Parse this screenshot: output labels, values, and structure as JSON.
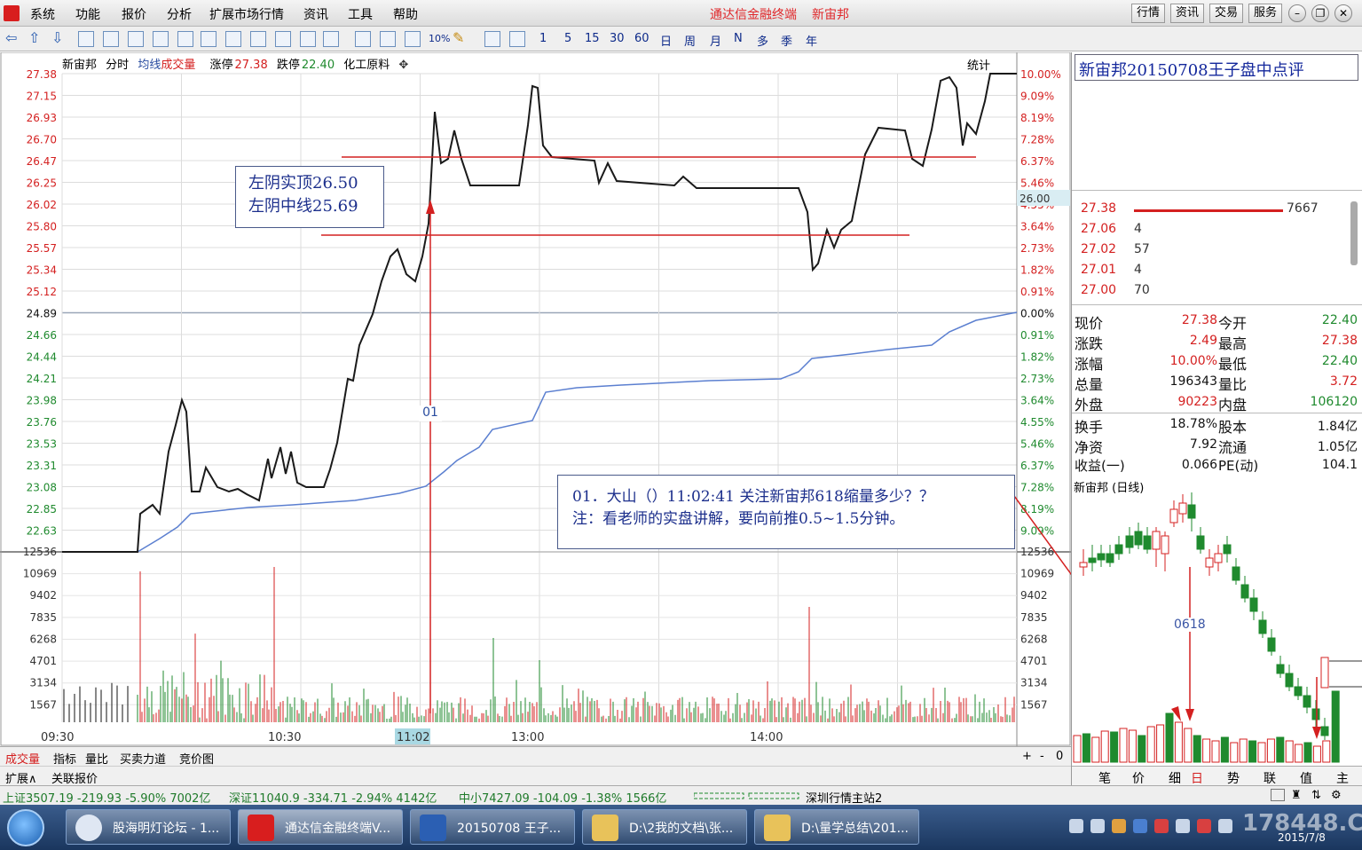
{
  "menu": {
    "items": [
      "系统",
      "功能",
      "报价",
      "分析",
      "扩展市场行情",
      "资讯",
      "工具",
      "帮助"
    ],
    "app_title": "通达信金融终端",
    "stock_title": "新宙邦",
    "right_buttons": [
      "行情",
      "资讯",
      "交易",
      "服务"
    ]
  },
  "toolbar": {
    "periods": [
      "1",
      "5",
      "15",
      "30",
      "60",
      "日",
      "周",
      "月",
      "N",
      "多",
      "季",
      "年"
    ],
    "pct_label": "10%"
  },
  "chart": {
    "stock_name": "新宙邦",
    "mode": "分时",
    "avg_label": "均线",
    "vol_label": "成交量",
    "limit_up_label": "涨停",
    "limit_up_value": "27.38",
    "limit_down_label": "跌停",
    "limit_down_value": "22.40",
    "sector": "化工原料",
    "stat_label": "统计",
    "price_ticks": [
      "27.38",
      "27.15",
      "26.93",
      "26.70",
      "26.47",
      "26.25",
      "26.02",
      "25.80",
      "25.57",
      "25.34",
      "25.12",
      "24.89",
      "24.66",
      "24.44",
      "24.21",
      "23.98",
      "23.76",
      "23.53",
      "23.31",
      "23.08",
      "22.85",
      "22.63"
    ],
    "pct_ticks": [
      "10.00%",
      "9.09%",
      "8.19%",
      "7.28%",
      "6.37%",
      "5.46%",
      "4.55%",
      "3.64%",
      "2.73%",
      "1.82%",
      "0.91%",
      "0.00%",
      "0.91%",
      "1.82%",
      "2.73%",
      "3.64%",
      "4.55%",
      "5.46%",
      "6.37%",
      "7.28%",
      "8.19%",
      "9.09%"
    ],
    "vol_ticks": [
      "12536",
      "10969",
      "9402",
      "7835",
      "6268",
      "4701",
      "3134",
      "1567"
    ],
    "time_ticks": [
      "09:30",
      "10:30",
      "11:02",
      "13:00",
      "14:00"
    ],
    "cursor_price": "26.00",
    "marker_label": "01"
  },
  "annotations": {
    "box1_line1": "左阴实顶26.50",
    "box1_line2": "左阴中线25.69",
    "box2_line1": "01．大山（）11:02:41  关注新宙邦618缩量多少？？",
    "box2_line2": "注：看老师的实盘讲解，要向前推0.5~1.5分钟。"
  },
  "bottom_tabs": [
    "成交量",
    "指标",
    "量比",
    "买卖力道",
    "竞价图"
  ],
  "bottom_controls": [
    "+",
    "-",
    "0"
  ],
  "expand_tabs": [
    "扩展∧",
    "关联报价"
  ],
  "right_panel": {
    "title": "新宙邦20150708王子盘中点评",
    "orderbook": [
      {
        "price": "27.38",
        "vol": "7667"
      },
      {
        "price": "27.06",
        "vol": "4"
      },
      {
        "price": "27.02",
        "vol": "57"
      },
      {
        "price": "27.01",
        "vol": "4"
      },
      {
        "price": "27.00",
        "vol": "70"
      }
    ],
    "quote": [
      {
        "l1": "现价",
        "v1": "27.38",
        "l2": "今开",
        "v2": "22.40"
      },
      {
        "l1": "涨跌",
        "v1": "2.49",
        "l2": "最高",
        "v2": "27.38"
      },
      {
        "l1": "涨幅",
        "v1": "10.00%",
        "l2": "最低",
        "v2": "22.40"
      },
      {
        "l1": "总量",
        "v1": "196343",
        "l2": "量比",
        "v2": "3.72"
      },
      {
        "l1": "外盘",
        "v1": "90223",
        "l2": "内盘",
        "v2": "106120"
      },
      {
        "l1": "换手",
        "v1": "18.78%",
        "l2": "股本",
        "v2": "1.84亿"
      },
      {
        "l1": "净资",
        "v1": "7.92",
        "l2": "流通",
        "v2": "1.05亿"
      },
      {
        "l1": "收益(一)",
        "v1": "0.066",
        "l2": "PE(动)",
        "v2": "104.1"
      }
    ],
    "daily_title": "新宙邦 (日线)",
    "daily_label": "0618",
    "tabs": [
      "笔",
      "价",
      "细",
      "日",
      "势",
      "联",
      "值",
      "主"
    ]
  },
  "status_bar": {
    "sh": "上证3507.19 -219.93 -5.90%  7002亿",
    "sz": "深证11040.9 -334.71 -2.94%  4142亿",
    "zx": "中小7427.09 -104.09 -1.38%  1566亿",
    "server": "深圳行情主站2"
  },
  "taskbar": {
    "tasks": [
      "股海明灯论坛 - 1...",
      "通达信金融终端V...",
      "20150708 王子...",
      "D:\\2我的文档\\张...",
      "D:\\量学总结\\201..."
    ],
    "watermark": "178448.COM",
    "date": "2015/7/8"
  },
  "colors": {
    "up": "#d42020",
    "down": "#1f8a2e",
    "price_line": "#1a1a1a",
    "avg_line": "#5b7fd0",
    "annotation": "#1c2f8c"
  }
}
